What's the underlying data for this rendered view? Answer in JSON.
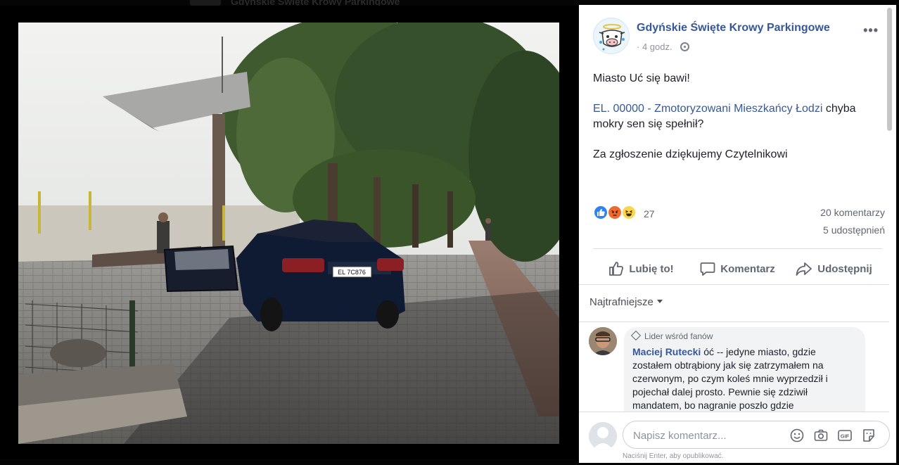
{
  "background": {
    "page_title": "Gdyńskie Święte Krowy Parkingowe"
  },
  "photo": {
    "plate_text": "EL 7C876"
  },
  "post": {
    "page_name": "Gdyńskie Święte Krowy Parkingowe",
    "time": "4 godz.",
    "time_separator": "·",
    "more_label": "•••",
    "line1": "Miasto Uć się bawi!",
    "link_text": "EL. 00000 - Zmotoryzowani Mieszkańcy Łodzi",
    "line2_rest": " chyba mokry sen się spełnił?",
    "line3": "Za zgłoszenie dziękujemy Czytelnikowi",
    "reactions_count": "27",
    "comments_count": "20 komentarzy",
    "shares_count": "5 udostępnień",
    "reaction_types": [
      "like",
      "angry",
      "haha"
    ]
  },
  "actions": {
    "like": "Lubię to!",
    "comment": "Komentarz",
    "share": "Udostępnij"
  },
  "comments": {
    "sort_label": "Najtrafniejsze",
    "items": [
      {
        "badge": "Lider wśród fanów",
        "author": "Maciej Rutecki",
        "text": "óć -- jedyne miasto, gdzie zostałem obtrąbiony jak się zatrzymałem na czerwonym, po czym koleś mnie wyprzedził i pojechał dalej prosto. Pewnie się zdziwił mandatem, bo nagranie poszło gdzie"
      }
    ]
  },
  "composer": {
    "placeholder": "Napisz komentarz...",
    "hint": "Naciśnij Enter, aby opublikować."
  },
  "colors": {
    "link": "#385898",
    "page_name": "#365899",
    "like_blue": "#2e82f6",
    "angry_orange": "#f06a2b",
    "haha_yellow": "#fbd54a"
  }
}
